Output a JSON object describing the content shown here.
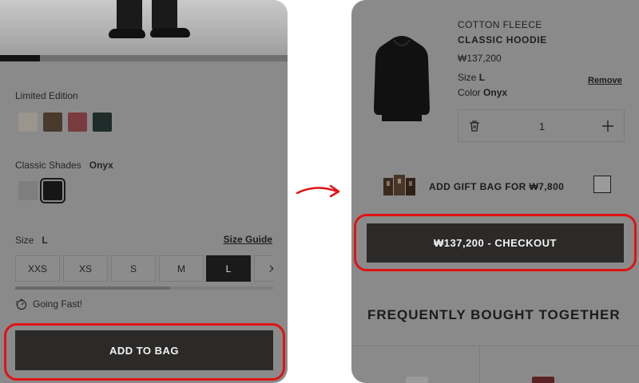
{
  "product_panel": {
    "image_progress_fraction": 0.14,
    "limited_edition_label": "Limited Edition",
    "limited_edition_swatches": [
      {
        "name": "cream",
        "color": "#9a968e"
      },
      {
        "name": "brown",
        "color": "#4a3a2c"
      },
      {
        "name": "red",
        "color": "#7a3b3e"
      },
      {
        "name": "dark-green",
        "color": "#1f2c29"
      }
    ],
    "classic_shades_label": "Classic Shades",
    "classic_shades_selected": "Onyx",
    "classic_swatches": [
      {
        "name": "grey",
        "color": "#7e7e7e"
      },
      {
        "name": "onyx",
        "color": "#161616"
      }
    ],
    "size_label": "Size",
    "size_selected": "L",
    "size_guide": "Size Guide",
    "sizes": [
      "XXS",
      "XS",
      "S",
      "M",
      "L",
      "XL"
    ],
    "size_scroll_fraction": 0.6,
    "going_fast": "Going Fast!",
    "add_to_bag": "ADD TO BAG"
  },
  "cart_panel": {
    "product_line": "COTTON FLEECE",
    "product_name": "CLASSIC HOODIE",
    "price": "₩137,200",
    "size_label": "Size",
    "size_value": "L",
    "color_label": "Color",
    "color_value": "Onyx",
    "remove": "Remove",
    "quantity": "1",
    "gift_bag_label": "ADD GIFT BAG FOR ₩7,800",
    "checkout_button": "₩137,200 - CHECKOUT",
    "frequently_bought": "FREQUENTLY BOUGHT TOGETHER"
  },
  "colors": {
    "highlight": "#e01313",
    "button_dark": "#2b2a29",
    "panel_overlay": "#8a8a8a"
  },
  "icons": [
    "trash-icon",
    "plus-icon",
    "stopwatch-icon",
    "arrow-icon"
  ]
}
